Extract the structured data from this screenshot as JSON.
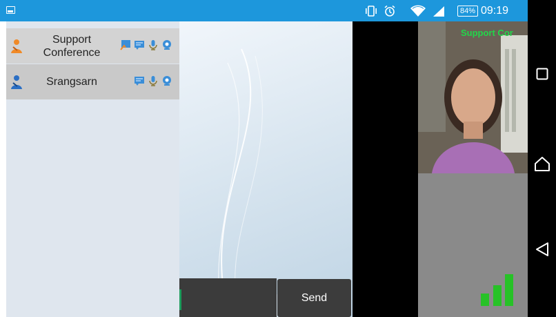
{
  "status_bar": {
    "battery_level": "84%",
    "time": "09:19",
    "icons": [
      "image-icon",
      "vibrate-icon",
      "alarm-icon",
      "wifi-icon",
      "signal-icon",
      "battery-icon"
    ]
  },
  "participants": [
    {
      "name": "Support\nConference",
      "icons": [
        "share-icon",
        "chat-icon",
        "mic-icon",
        "webcam-icon"
      ]
    },
    {
      "name": "Srangsarn",
      "icons": [
        "chat-icon",
        "mic-icon",
        "webcam-icon"
      ]
    }
  ],
  "chat": {
    "input_value": "",
    "send_label": "Send"
  },
  "video": {
    "overlay_label": "Support Cor"
  },
  "connection_quality_bars": 3,
  "colors": {
    "status_bar": "#1d97dc",
    "participant_row": "#c9c9c9",
    "signal_green": "#27c227",
    "video_label": "#22d64a"
  }
}
